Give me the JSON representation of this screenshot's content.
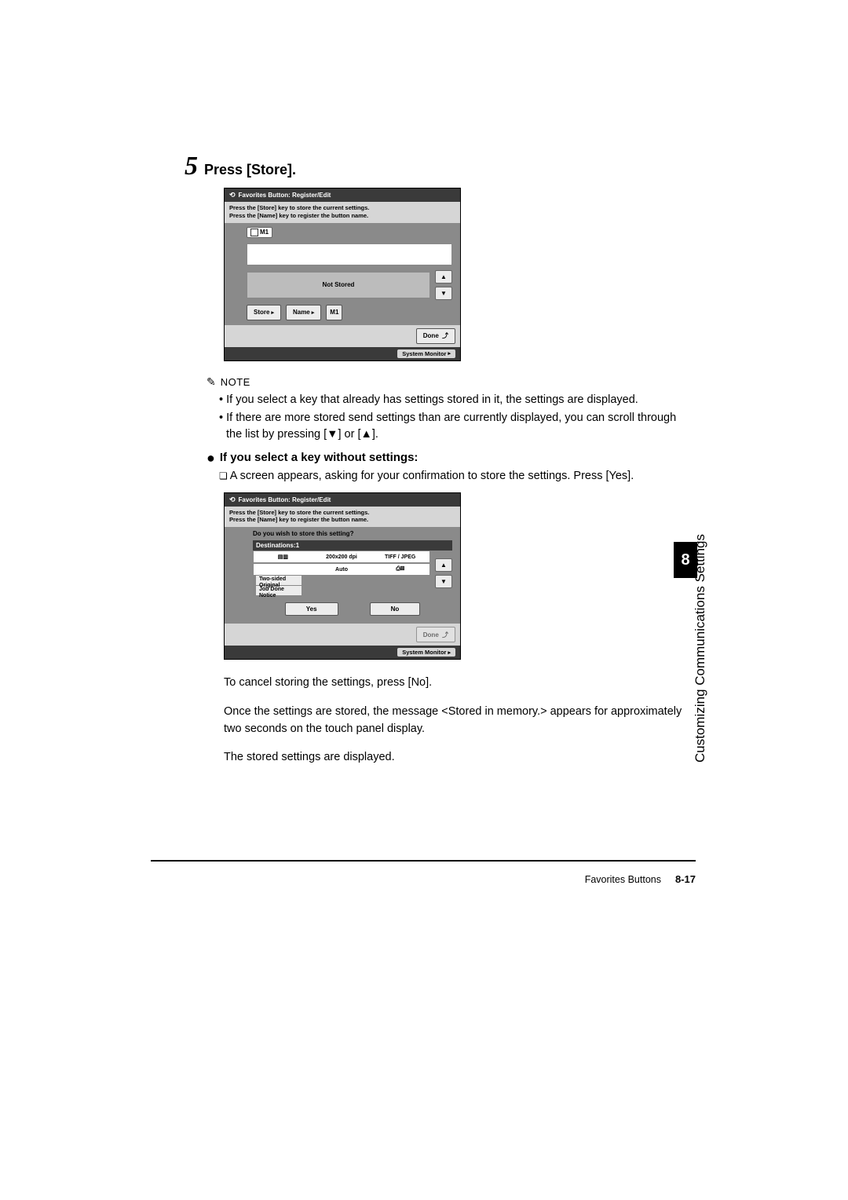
{
  "step": {
    "number": "5",
    "title": "Press [Store]."
  },
  "screenshot1": {
    "title": "Favorites Button: Register/Edit",
    "instruction_line1": "Press the [Store] key to store the current settings.",
    "instruction_line2": "Press the [Name] key to register the button name.",
    "slot_label": "M1",
    "not_stored": "Not Stored",
    "store_btn": "Store",
    "name_btn": "Name",
    "m1_btn": "M1",
    "done_btn": "Done",
    "sysmonitor": "System Monitor"
  },
  "note": {
    "label": "NOTE",
    "items": [
      "If you select a key that already has settings stored in it, the settings are displayed.",
      "If there are more stored send settings than are currently displayed, you can scroll through the list by pressing [▼] or [▲]."
    ]
  },
  "subhead": "If you select a key without settings:",
  "subpara": "A screen appears, asking for your confirmation to store the settings. Press [Yes].",
  "screenshot2": {
    "title": "Favorites Button: Register/Edit",
    "instruction_line1": "Press the [Store] key to store the current settings.",
    "instruction_line2": "Press the [Name] key to register the button name.",
    "question": "Do you wish to store this setting?",
    "destinations": "Destinations:1",
    "c1": "200x200 dpi",
    "c2": "TIFF / JPEG",
    "c3": "Auto",
    "toggle1": "Two-sided Original",
    "toggle2": "Job Done Notice",
    "yes": "Yes",
    "no": "No",
    "done_btn": "Done",
    "sysmonitor": "System Monitor"
  },
  "after": {
    "p1": "To cancel storing the settings, press [No].",
    "p2": "Once the settings are stored, the message <Stored in memory.> appears for approximately two seconds on the touch panel display.",
    "p3": "The stored settings are displayed."
  },
  "footer": {
    "section": "Favorites Buttons",
    "page": "8-17"
  },
  "sidebar": {
    "chapter": "8",
    "title": "Customizing Communications Settings"
  }
}
